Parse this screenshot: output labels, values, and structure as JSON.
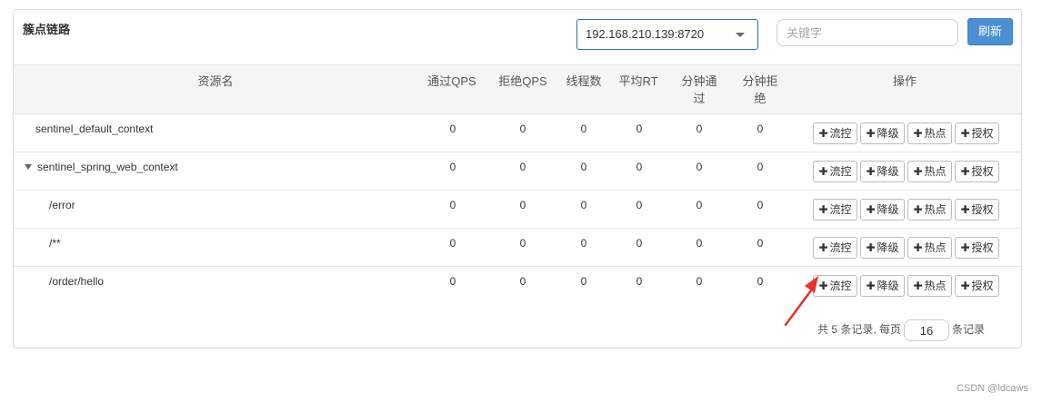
{
  "panel": {
    "title": "簇点链路"
  },
  "machine_select": {
    "value": "192.168.210.139:8720"
  },
  "search": {
    "placeholder": "关键字"
  },
  "refresh_label": "刷新",
  "headers": {
    "name": "资源名",
    "pass_qps": "通过QPS",
    "block_qps": "拒绝QPS",
    "threads": "线程数",
    "avg_rt": "平均RT",
    "minute_pass": "分钟通过",
    "minute_block": "分钟拒绝",
    "ops": "操作"
  },
  "actions": {
    "flow": "流控",
    "degrade": "降级",
    "hotspot": "热点",
    "auth": "授权"
  },
  "rows": [
    {
      "name": "sentinel_default_context",
      "pass_qps": "0",
      "block_qps": "0",
      "threads": "0",
      "avg_rt": "0",
      "minute_pass": "0",
      "minute_block": "0"
    },
    {
      "name": "sentinel_spring_web_context",
      "pass_qps": "0",
      "block_qps": "0",
      "threads": "0",
      "avg_rt": "0",
      "minute_pass": "0",
      "minute_block": "0"
    },
    {
      "name": "/error",
      "pass_qps": "0",
      "block_qps": "0",
      "threads": "0",
      "avg_rt": "0",
      "minute_pass": "0",
      "minute_block": "0"
    },
    {
      "name": "/**",
      "pass_qps": "0",
      "block_qps": "0",
      "threads": "0",
      "avg_rt": "0",
      "minute_pass": "0",
      "minute_block": "0"
    },
    {
      "name": "/order/hello",
      "pass_qps": "0",
      "block_qps": "0",
      "threads": "0",
      "avg_rt": "0",
      "minute_pass": "0",
      "minute_block": "0"
    }
  ],
  "pager": {
    "prefix": "共 5 条记录, 每页",
    "page_size": "16",
    "suffix": "条记录"
  },
  "watermark": "CSDN @ldcaws",
  "colors": {
    "primary": "#4a90d3",
    "arrow": "#e8312a"
  },
  "icons": {
    "plus": "plus-icon",
    "tree_toggle": "caret-down-icon",
    "dropdown": "chevron-down-icon"
  }
}
